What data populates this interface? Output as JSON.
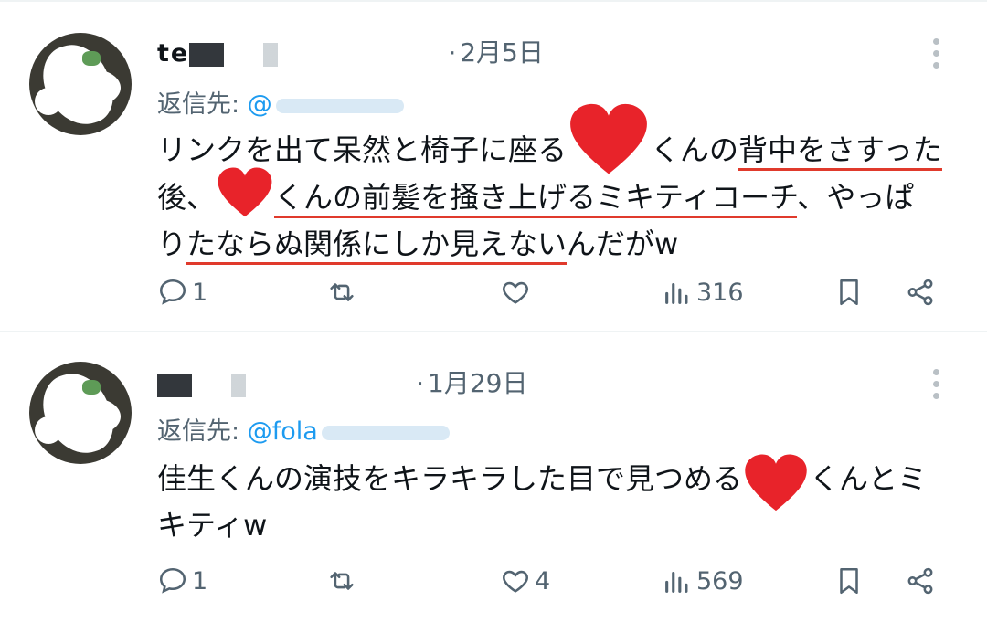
{
  "posts": [
    {
      "name_visible": "te",
      "separator": "·",
      "date": "2月5日",
      "reply_prefix": "返信先:",
      "reply_handle": "@",
      "lines": [
        [
          "リンクを出て呆然と椅子に座る",
          "くんの",
          "背中をさすった"
        ],
        [
          "後、",
          "くんの前髪を掻き上げるミキティコーチ",
          "、やっぱ"
        ],
        [
          "り",
          "たならぬ関係にしか見えない",
          "んだがw"
        ]
      ],
      "metrics": {
        "replies": "1",
        "reposts": "",
        "likes": "",
        "views": "316"
      }
    },
    {
      "name_visible": "",
      "separator": "·",
      "date": "1月29日",
      "reply_prefix": "返信先:",
      "reply_handle": "@fola",
      "lines": [
        [
          "佳生くんの演技をキラキラした目で見つめる",
          "くんとミ"
        ],
        [
          "キティw"
        ]
      ],
      "metrics": {
        "replies": "1",
        "reposts": "",
        "likes": "4",
        "views": "569"
      }
    }
  ],
  "icons": {
    "reply": "reply-icon",
    "repost": "repost-icon",
    "like": "heart-icon",
    "views": "views-icon",
    "bookmark": "bookmark-icon",
    "share": "share-icon",
    "more": "more-icon",
    "sticker": "red-heart-sticker"
  },
  "colors": {
    "accent": "#1d9bf0",
    "muted": "#536471",
    "underline": "#e03a2c",
    "heart": "#e8232a"
  }
}
